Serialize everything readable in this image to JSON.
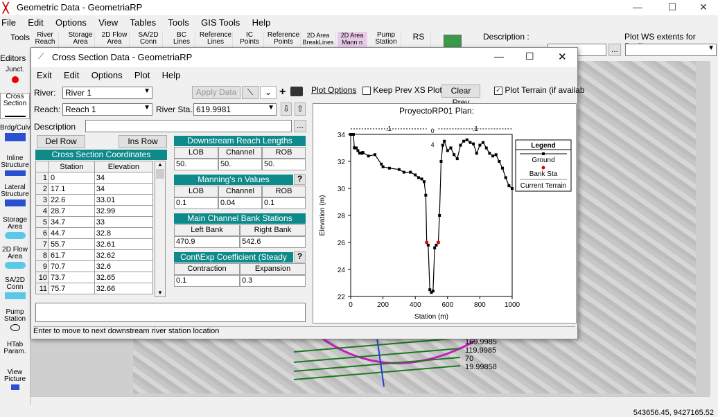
{
  "app": {
    "title": "Geometric Data - GeometriaRP",
    "menu": [
      "File",
      "Edit",
      "Options",
      "View",
      "Tables",
      "Tools",
      "GIS Tools",
      "Help"
    ],
    "toolbar_label": "Tools",
    "toolbar_buttons": [
      "River Reach",
      "Storage Area",
      "2D Flow Area",
      "SA/2D Conn",
      "BC Lines",
      "Reference Lines",
      "IC Points",
      "Reference Points",
      "2D Area BreakLines",
      "2D Area Mann n",
      "Pump Station",
      "RS"
    ],
    "description_label": "Description :",
    "plot_ws_label": "Plot WS extents for Profile:",
    "editors_label": "Editors",
    "sidebar": [
      "Junct.",
      "Cross Section",
      "Brdg/Culv",
      "Inline Structure",
      "Lateral Structure",
      "Storage Area",
      "2D Flow Area",
      "SA/2D Conn",
      "Pump Station",
      "HTab Param.",
      "View Picture"
    ],
    "map_labels": [
      "169.9985",
      "119.9985",
      "70",
      "19.99858"
    ],
    "coordinates": "543656.45, 9427165.52"
  },
  "dialog": {
    "title": "Cross Section Data - GeometriaRP",
    "menu": [
      "Exit",
      "Edit",
      "Options",
      "Plot",
      "Help"
    ],
    "river_label": "River:",
    "river_value": "River 1",
    "reach_label": "Reach:",
    "reach_value": "Reach 1",
    "river_sta_label": "River Sta.:",
    "river_sta_value": "619.9981",
    "apply_data": "Apply Data",
    "description_label": "Description",
    "del_row": "Del Row",
    "ins_row": "Ins Row",
    "xs_header": "Cross Section Coordinates",
    "xs_columns": [
      "Station",
      "Elevation"
    ],
    "xs_rows": [
      [
        "1",
        "0",
        "34"
      ],
      [
        "2",
        "17.1",
        "34"
      ],
      [
        "3",
        "22.6",
        "33.01"
      ],
      [
        "4",
        "28.7",
        "32.99"
      ],
      [
        "5",
        "34.7",
        "33"
      ],
      [
        "6",
        "44.7",
        "32.8"
      ],
      [
        "7",
        "55.7",
        "32.61"
      ],
      [
        "8",
        "61.7",
        "32.62"
      ],
      [
        "9",
        "70.7",
        "32.6"
      ],
      [
        "10",
        "73.7",
        "32.65"
      ],
      [
        "11",
        "75.7",
        "32.66"
      ]
    ],
    "downstream_header": "Downstream Reach Lengths",
    "lob_channel_rob": [
      "LOB",
      "Channel",
      "ROB"
    ],
    "reach_lengths": [
      "50.",
      "50.",
      "50."
    ],
    "mannings_header": "Manning's n Values",
    "mannings_values": [
      "0.1",
      "0.04",
      "0.1"
    ],
    "bank_header": "Main Channel Bank Stations",
    "bank_columns": [
      "Left Bank",
      "Right Bank"
    ],
    "bank_values": [
      "470.9",
      "542.6"
    ],
    "coef_header": "Cont\\Exp Coefficient (Steady",
    "coef_columns": [
      "Contraction",
      "Expansion"
    ],
    "coef_values": [
      "0.1",
      "0.3"
    ],
    "plot_options": "Plot Options",
    "keep_prev": "Keep Prev XS Plots",
    "clear_prev": "Clear Prev",
    "plot_terrain": "Plot Terrain (if availab",
    "status": "Enter to move to next downstream river station location"
  },
  "chart_data": {
    "type": "line",
    "title": "ProyectoRP01     Plan:",
    "xlabel": "Station (m)",
    "ylabel": "Elevation (m)",
    "xlim": [
      0,
      1000
    ],
    "ylim": [
      22,
      34
    ],
    "xticks": [
      0,
      200,
      400,
      600,
      800,
      1000
    ],
    "yticks": [
      22,
      24,
      26,
      28,
      30,
      32,
      34
    ],
    "n_values_top": [
      ".1",
      "0\n4",
      ".1"
    ],
    "legend_title": "Legend",
    "legend": [
      "Ground",
      "Bank Sta",
      "Current Terrain"
    ],
    "series": [
      {
        "name": "Ground",
        "x": [
          0,
          17.1,
          22.6,
          28.7,
          34.7,
          44.7,
          55.7,
          61.7,
          70.7,
          73.7,
          75.7,
          110,
          150,
          190,
          200,
          240,
          300,
          330,
          370,
          400,
          420,
          440,
          455,
          465,
          470.9,
          480,
          490,
          500,
          510,
          520,
          530,
          542.6,
          550,
          560,
          570,
          580,
          600,
          620,
          640,
          660,
          680,
          700,
          720,
          740,
          760,
          780,
          800,
          820,
          840,
          860,
          880,
          900,
          920,
          940,
          960,
          980,
          1000
        ],
        "y": [
          34,
          34,
          33.01,
          32.99,
          33,
          32.8,
          32.61,
          32.62,
          32.6,
          32.65,
          32.66,
          32.4,
          32.5,
          31.8,
          31.6,
          31.5,
          31.4,
          31.2,
          31.2,
          31.0,
          30.8,
          30.7,
          30.5,
          29.5,
          26.0,
          25.8,
          22.5,
          22.3,
          22.4,
          25.6,
          25.8,
          26.0,
          28.0,
          32.0,
          33.2,
          33.5,
          32.8,
          33.0,
          32.5,
          32.2,
          33.2,
          33.5,
          33.6,
          33.4,
          33.3,
          32.6,
          33.2,
          33.4,
          33.0,
          32.6,
          32.4,
          32.5,
          32.0,
          31.5,
          30.8,
          30.2,
          30.0
        ]
      },
      {
        "name": "Bank Sta",
        "x": [
          470.9,
          542.6
        ],
        "y": [
          26.0,
          26.0
        ]
      }
    ]
  }
}
